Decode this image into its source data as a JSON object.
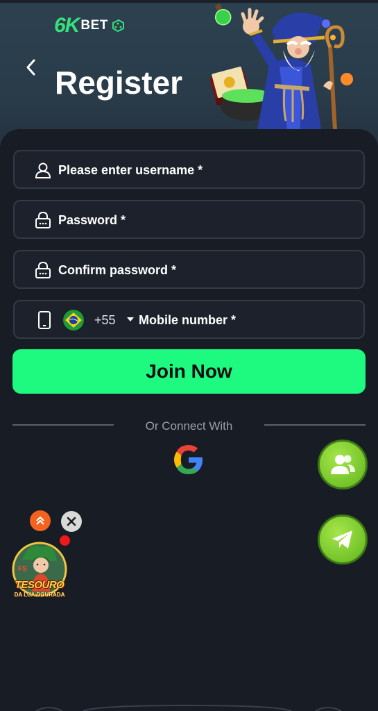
{
  "brand": {
    "logo_left": "6K",
    "logo_right": "BET"
  },
  "header": {
    "title": "Register"
  },
  "form": {
    "username_label": "Please enter username *",
    "password_label": "Password *",
    "confirm_label": "Confirm password *",
    "country_code": "+55",
    "mobile_label": "Mobile number *",
    "country_flag": "brazil-flag-icon"
  },
  "actions": {
    "join_label": "Join Now"
  },
  "connect": {
    "label": "Or Connect With"
  },
  "promo": {
    "line1": "TESOURO",
    "line2": "DA LUA DOURADA",
    "badge_tag": "FS"
  },
  "colors": {
    "accent": "#1dfa7f",
    "background": "#181c24",
    "field_border": "#323a46",
    "fab_green": "#74c42a",
    "promo_orange": "#f4621f"
  },
  "icons": [
    "back-chevron-icon",
    "user-icon",
    "lock-icon",
    "phone-icon",
    "google-icon",
    "group-icon",
    "telegram-icon",
    "double-chevron-up-icon",
    "close-icon"
  ]
}
